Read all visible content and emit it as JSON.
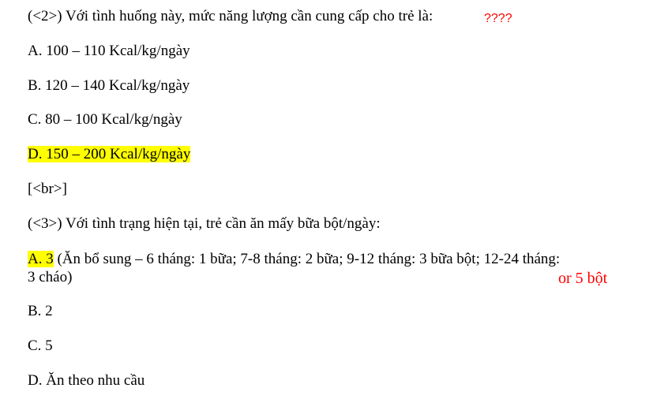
{
  "question2": {
    "text": "(<2>) Với tình huống này, mức năng lượng cần cung cấp cho trẻ là:",
    "annotation": "????",
    "options": [
      "A. 100 – 110 Kcal/kg/ngày",
      "B. 120 – 140 Kcal/kg/ngày",
      "C. 80 – 100 Kcal/kg/ngày",
      "D. 150 – 200 Kcal/kg/ngày"
    ]
  },
  "separator": "[<br>]",
  "question3": {
    "text": "(<3>) Với tình trạng hiện tại, trẻ cần ăn mấy bữa bột/ngày:",
    "option_a_label": "A. 3",
    "option_a_note_line1": " (Ăn bổ sung – 6 tháng: 1 bữa; 7-8 tháng: 2 bữa; 9-12 tháng: 3 bữa bột; 12-24 tháng:",
    "option_a_note_line2": "3 cháo)",
    "annotation": "or 5 bột",
    "options": [
      "B. 2",
      "C. 5",
      "D. Ăn theo nhu cầu"
    ]
  },
  "colors": {
    "highlight": "#ffff00",
    "annotation": "#ff0000",
    "text": "#000000"
  }
}
